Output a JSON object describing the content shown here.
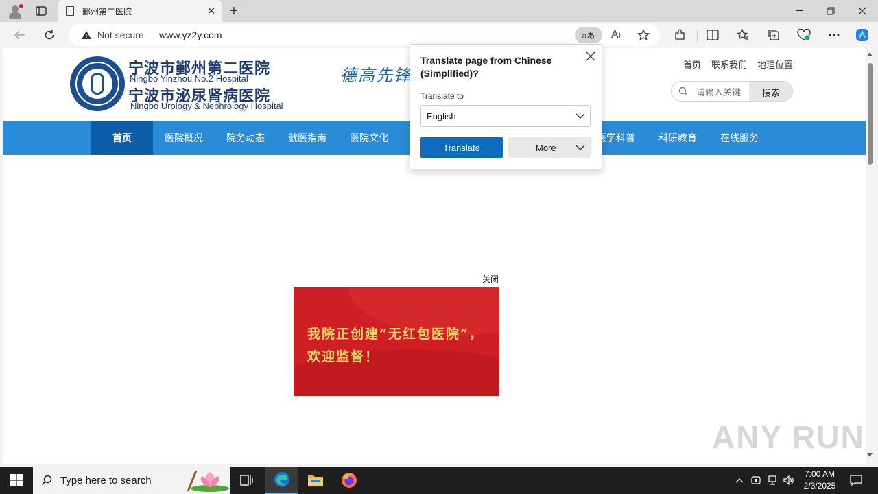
{
  "browser": {
    "tab_title": "鄞州第二医院",
    "address": {
      "security_label": "Not secure",
      "url": "www.yz2y.com"
    }
  },
  "site": {
    "hospital_name_1": "宁波市鄞州第二医院",
    "hospital_name_1_en": "Ningbo Yinzhou No.2 Hospital",
    "hospital_name_2": "宁波市泌尿肾病医院",
    "hospital_name_2_en": "Ningbo Urology & Nephrology Hospital",
    "slogan": "德高先锋",
    "top_links": [
      "首页",
      "联系我们",
      "地理位置"
    ],
    "search": {
      "placeholder": "请输入关键",
      "button": "搜索"
    },
    "nav": [
      "首页",
      "医院概况",
      "院务动态",
      "就医指南",
      "医院文化",
      "医学科普",
      "科研教育",
      "在线服务"
    ],
    "popup": {
      "close_label": "关闭",
      "banner_text": "我院正创建“无红包医院”，欢迎监督！"
    },
    "watermark": "ANY RUN"
  },
  "translate_popup": {
    "title": "Translate page from Chinese (Simplified)?",
    "translate_to_label": "Translate to",
    "language": "English",
    "translate_button": "Translate",
    "more_button": "More"
  },
  "taskbar": {
    "search_placeholder": "Type here to search",
    "time": "7:00 AM",
    "date": "2/3/2025"
  },
  "colors": {
    "nav_bg": "#2a8bd8",
    "nav_active": "#0c5ea8",
    "primary_button": "#0f6cbd",
    "banner_red": "#cf1f24",
    "banner_text": "#f6d56b"
  }
}
